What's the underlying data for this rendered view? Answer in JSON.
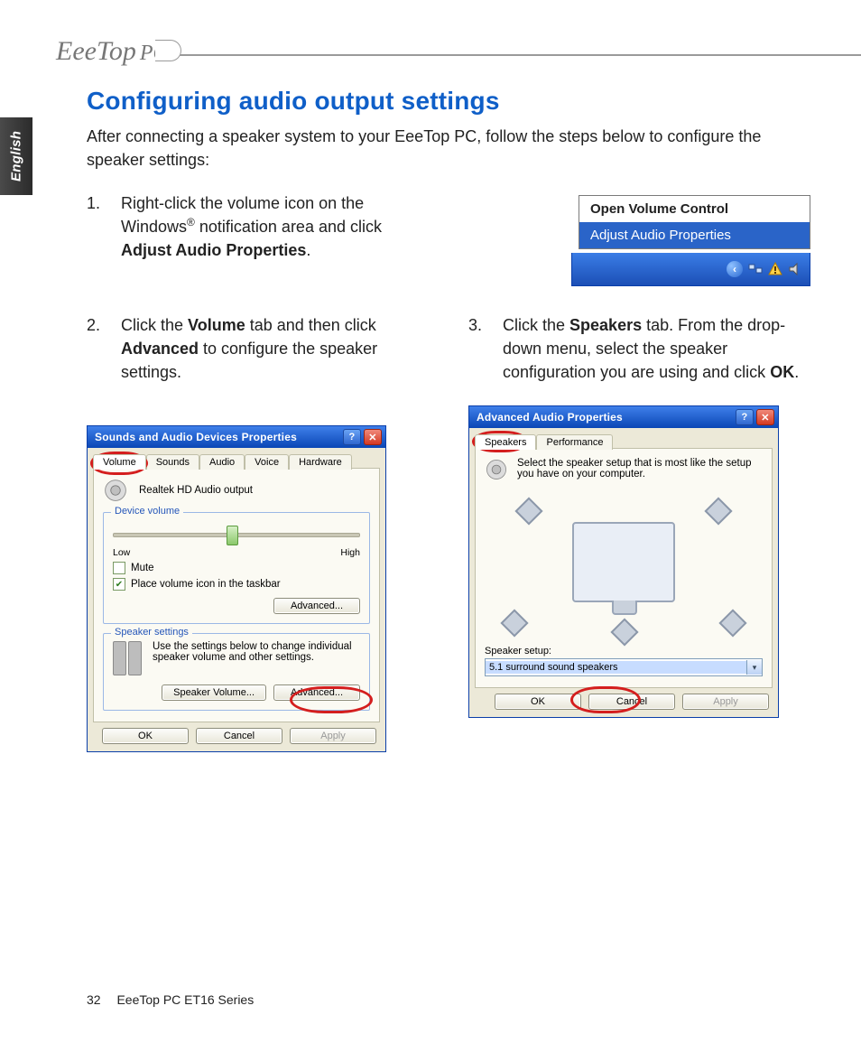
{
  "brand": {
    "name": "EeeTop",
    "suffix": "PC"
  },
  "language_tab": "English",
  "heading": "Configuring audio output settings",
  "intro": "After connecting a speaker system to your EeeTop PC, follow the steps below to configure the speaker settings:",
  "step1": {
    "num": "1.",
    "text_a": "Right-click the volume icon on the Windows",
    "reg": "®",
    "text_b": " notification area and click ",
    "bold": "Adjust Audio Properties",
    "text_c": "."
  },
  "context_menu": {
    "item1": "Open Volume Control",
    "item2": "Adjust Audio Properties"
  },
  "step2": {
    "num": "2.",
    "t1": "Click the ",
    "b1": "Volume",
    "t2": " tab and then click ",
    "b2": "Advanced",
    "t3": " to configure the speaker settings."
  },
  "step3": {
    "num": "3.",
    "t1": "Click the ",
    "b1": "Speakers",
    "t2": " tab. From the drop-down menu, select the speaker configuration you are using and click ",
    "b2": "OK",
    "t3": "."
  },
  "dialog1": {
    "title": "Sounds and Audio Devices Properties",
    "tabs": {
      "volume": "Volume",
      "sounds": "Sounds",
      "audio": "Audio",
      "voice": "Voice",
      "hardware": "Hardware"
    },
    "device_name": "Realtek HD Audio output",
    "group_device_volume": "Device volume",
    "low": "Low",
    "high": "High",
    "mute": "Mute",
    "place_icon": "Place volume icon in the taskbar",
    "advanced": "Advanced...",
    "group_speaker": "Speaker settings",
    "speaker_text": "Use the settings below to change individual speaker volume and other settings.",
    "speaker_volume": "Speaker Volume...",
    "ok": "OK",
    "cancel": "Cancel",
    "apply": "Apply"
  },
  "dialog2": {
    "title": "Advanced Audio Properties",
    "tabs": {
      "speakers": "Speakers",
      "performance": "Performance"
    },
    "instruction": "Select the speaker setup that is most like the setup you have on your computer.",
    "label": "Speaker setup:",
    "value": "5.1 surround sound speakers",
    "ok": "OK",
    "cancel": "Cancel",
    "apply": "Apply"
  },
  "footer": {
    "page": "32",
    "doc": "EeeTop PC ET16 Series"
  }
}
